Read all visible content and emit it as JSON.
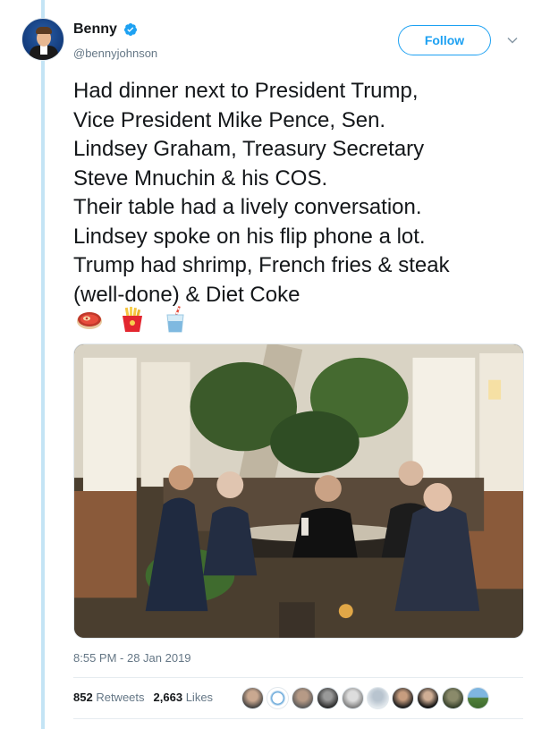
{
  "user": {
    "display_name": "Benny",
    "handle": "@bennyjohnson",
    "verified": true,
    "avatar_icon": "avatar-icon"
  },
  "actions": {
    "follow_label": "Follow",
    "menu_icon": "chevron-down-icon"
  },
  "tweet": {
    "lines": [
      "Had dinner next to President Trump,",
      "Vice President Mike Pence, Sen.",
      "Lindsey Graham, Treasury Secretary",
      "Steve Mnuchin & his COS.",
      "Their table had a lively conversation.",
      "Lindsey spoke on his flip phone a lot.",
      "Trump had shrimp, French fries & steak",
      "(well-done) & Diet Coke"
    ],
    "emojis": [
      "steak-emoji",
      "french-fries-emoji",
      "cup-with-straw-emoji"
    ]
  },
  "media": {
    "photo": "restaurant-dinner-photo"
  },
  "meta": {
    "timestamp": "8:55 PM - 28 Jan 2019",
    "retweets_count": "852",
    "retweets_label": "Retweets",
    "likes_count": "2,663",
    "likes_label": "Likes",
    "liker_avatars": 10
  },
  "colors": {
    "accent": "#1da1f2",
    "thread_line": "#c4e4f5",
    "secondary_text": "#657786"
  }
}
